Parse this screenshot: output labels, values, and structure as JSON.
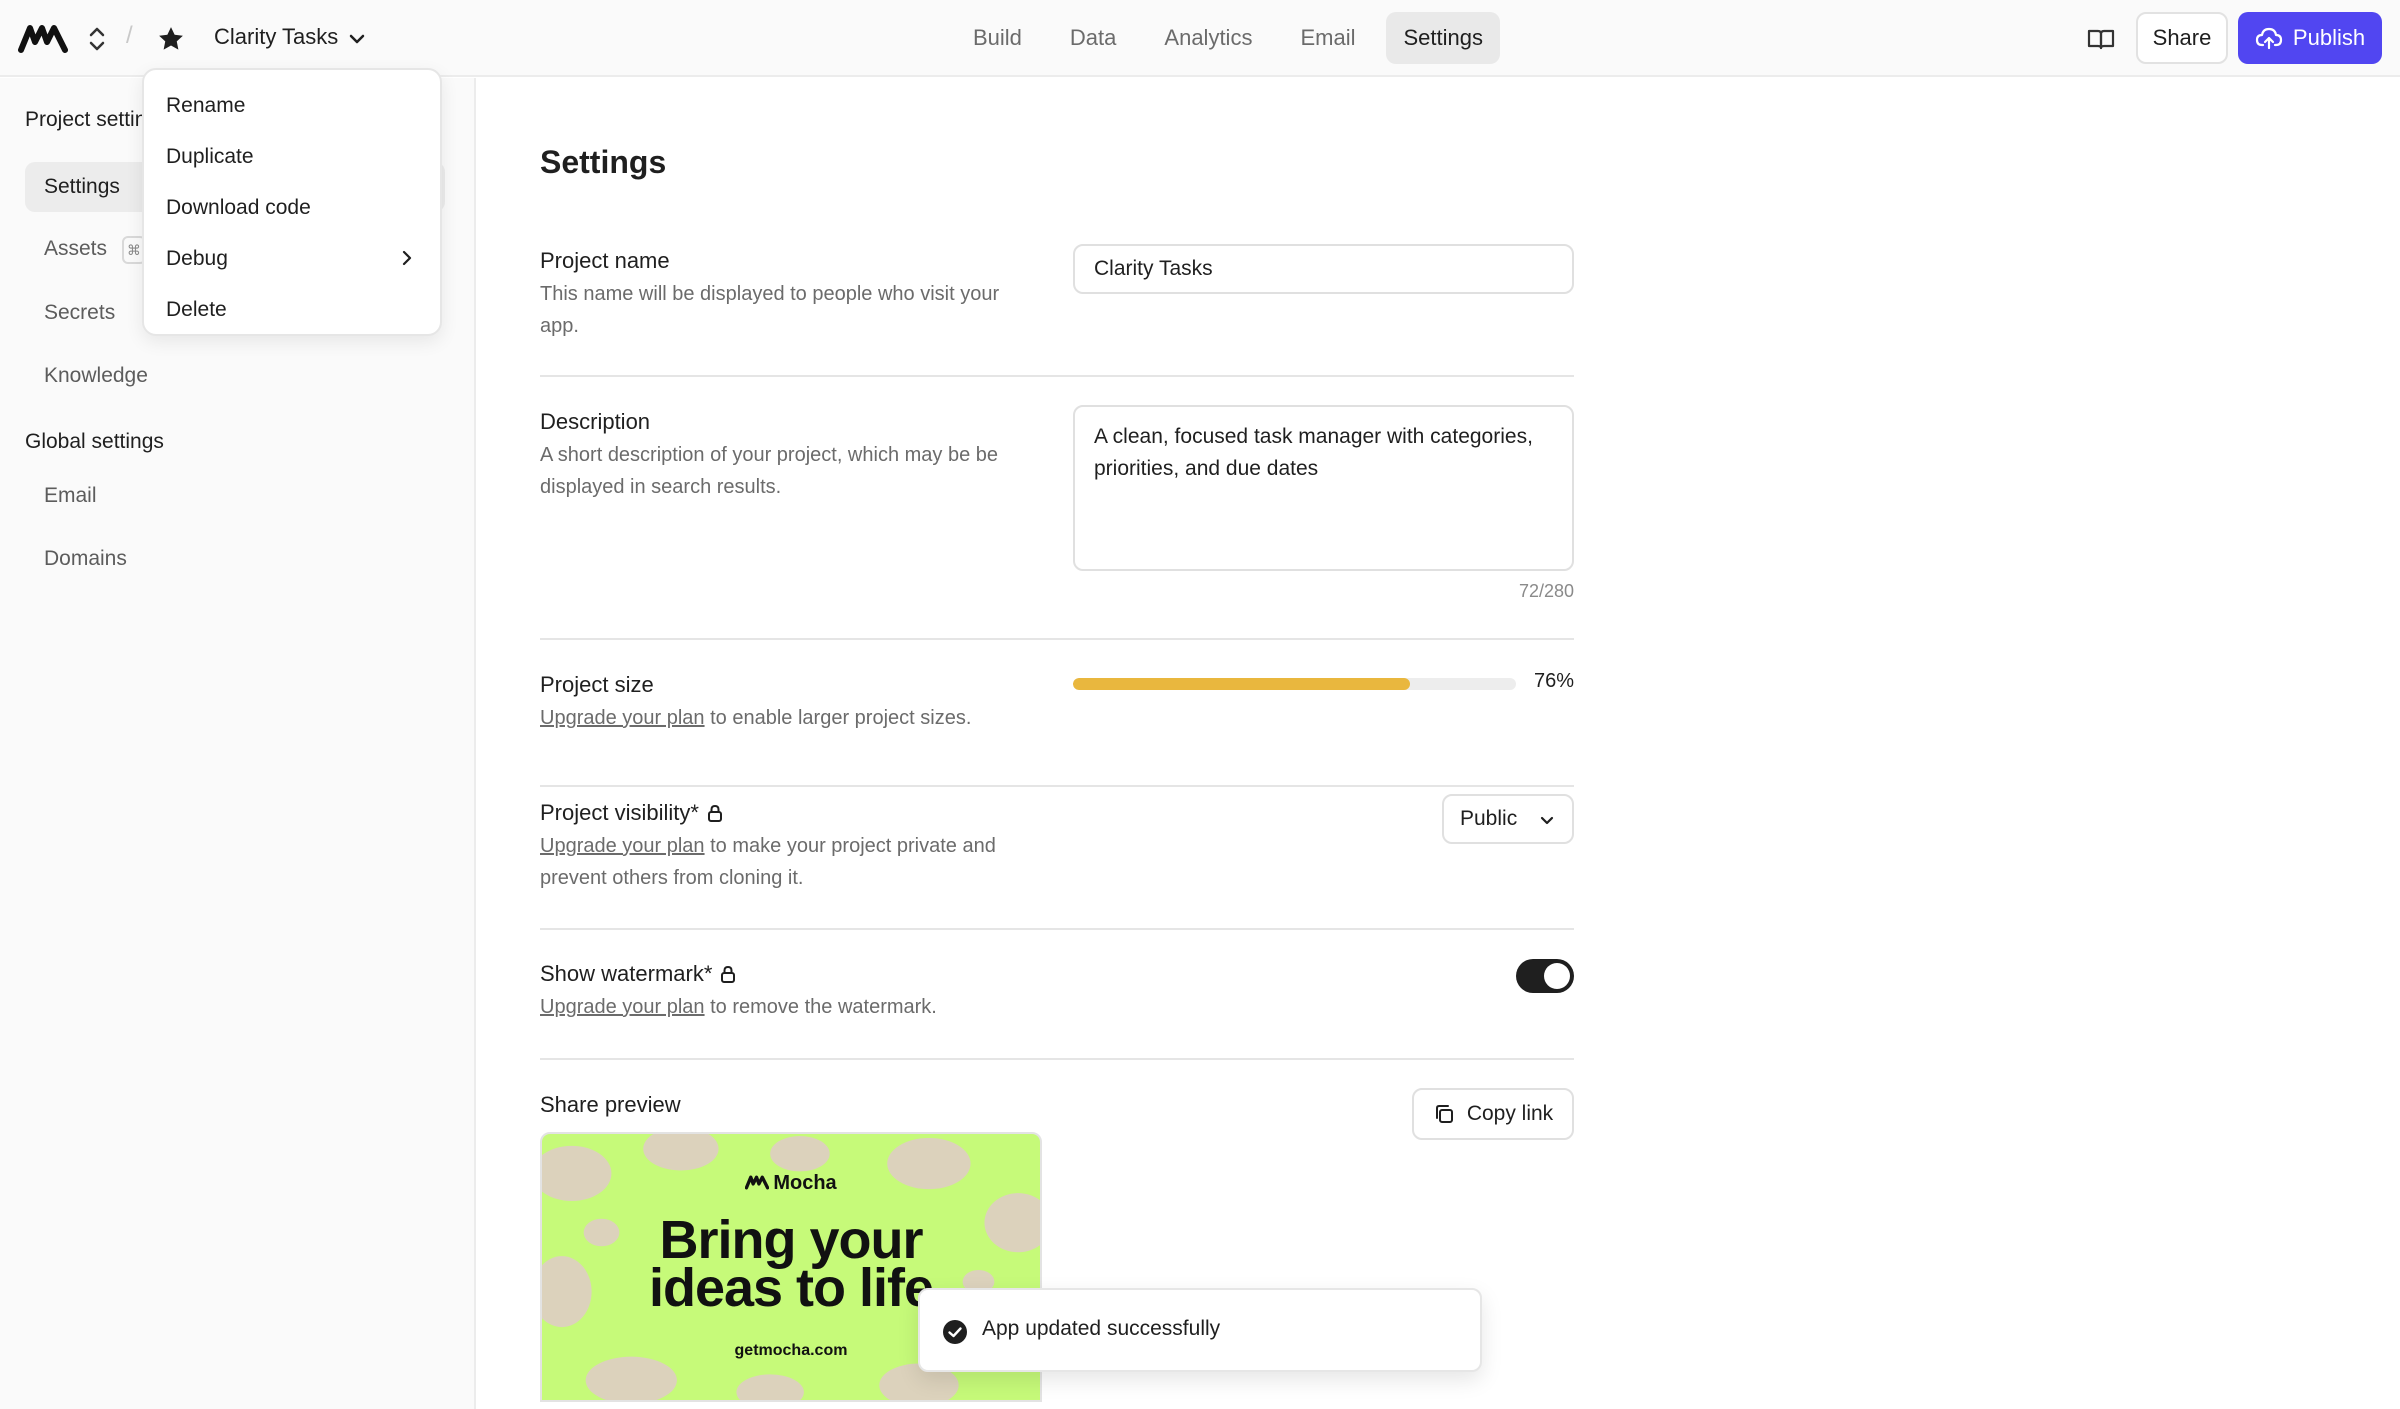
{
  "header": {
    "project_name": "Clarity Tasks",
    "tabs": [
      {
        "label": "Build"
      },
      {
        "label": "Data"
      },
      {
        "label": "Analytics"
      },
      {
        "label": "Email"
      },
      {
        "label": "Settings"
      }
    ],
    "active_tab": "Settings",
    "share_label": "Share",
    "publish_label": "Publish",
    "accent_color": "#5146f1"
  },
  "sidebar": {
    "project_heading": "Project settings",
    "project_items": [
      {
        "label": "Settings"
      },
      {
        "label": "Assets"
      },
      {
        "label": "Secrets"
      },
      {
        "label": "Knowledge"
      }
    ],
    "assets_shortcut": "⌘",
    "global_heading": "Global settings",
    "global_items": [
      {
        "label": "Email"
      },
      {
        "label": "Domains"
      }
    ]
  },
  "project_menu": {
    "items": [
      {
        "label": "Rename"
      },
      {
        "label": "Duplicate"
      },
      {
        "label": "Download code"
      },
      {
        "label": "Debug"
      },
      {
        "label": "Delete"
      }
    ]
  },
  "settings": {
    "title": "Settings",
    "name": {
      "label": "Project name",
      "help": "This name will be displayed to people who visit your app.",
      "value": "Clarity Tasks"
    },
    "description": {
      "label": "Description",
      "help": "A short description of your project, which may be be displayed in search results.",
      "value": "A clean, focused task manager with categories, priorities, and due dates",
      "counter": "72/280"
    },
    "size": {
      "label": "Project size",
      "upgrade_link": "Upgrade your plan",
      "help_rest": " to enable larger project sizes.",
      "percent_label": "76%",
      "percent_value": 76,
      "bar_color": "#e9b73e"
    },
    "visibility": {
      "label": "Project visibility*",
      "upgrade_link": "Upgrade your plan",
      "help_rest": " to make your project private and prevent others from cloning it.",
      "selected": "Public"
    },
    "watermark": {
      "label": "Show watermark*",
      "upgrade_link": "Upgrade your plan",
      "help_rest": " to remove the watermark.",
      "enabled": true
    },
    "share_preview": {
      "label": "Share preview",
      "copy_label": "Copy link",
      "brand": "Mocha",
      "headline_line1": "Bring your",
      "headline_line2": "ideas to life",
      "url": "getmocha.com",
      "bg_color": "#c6fa79"
    }
  },
  "toast": {
    "message": "App updated successfully"
  }
}
